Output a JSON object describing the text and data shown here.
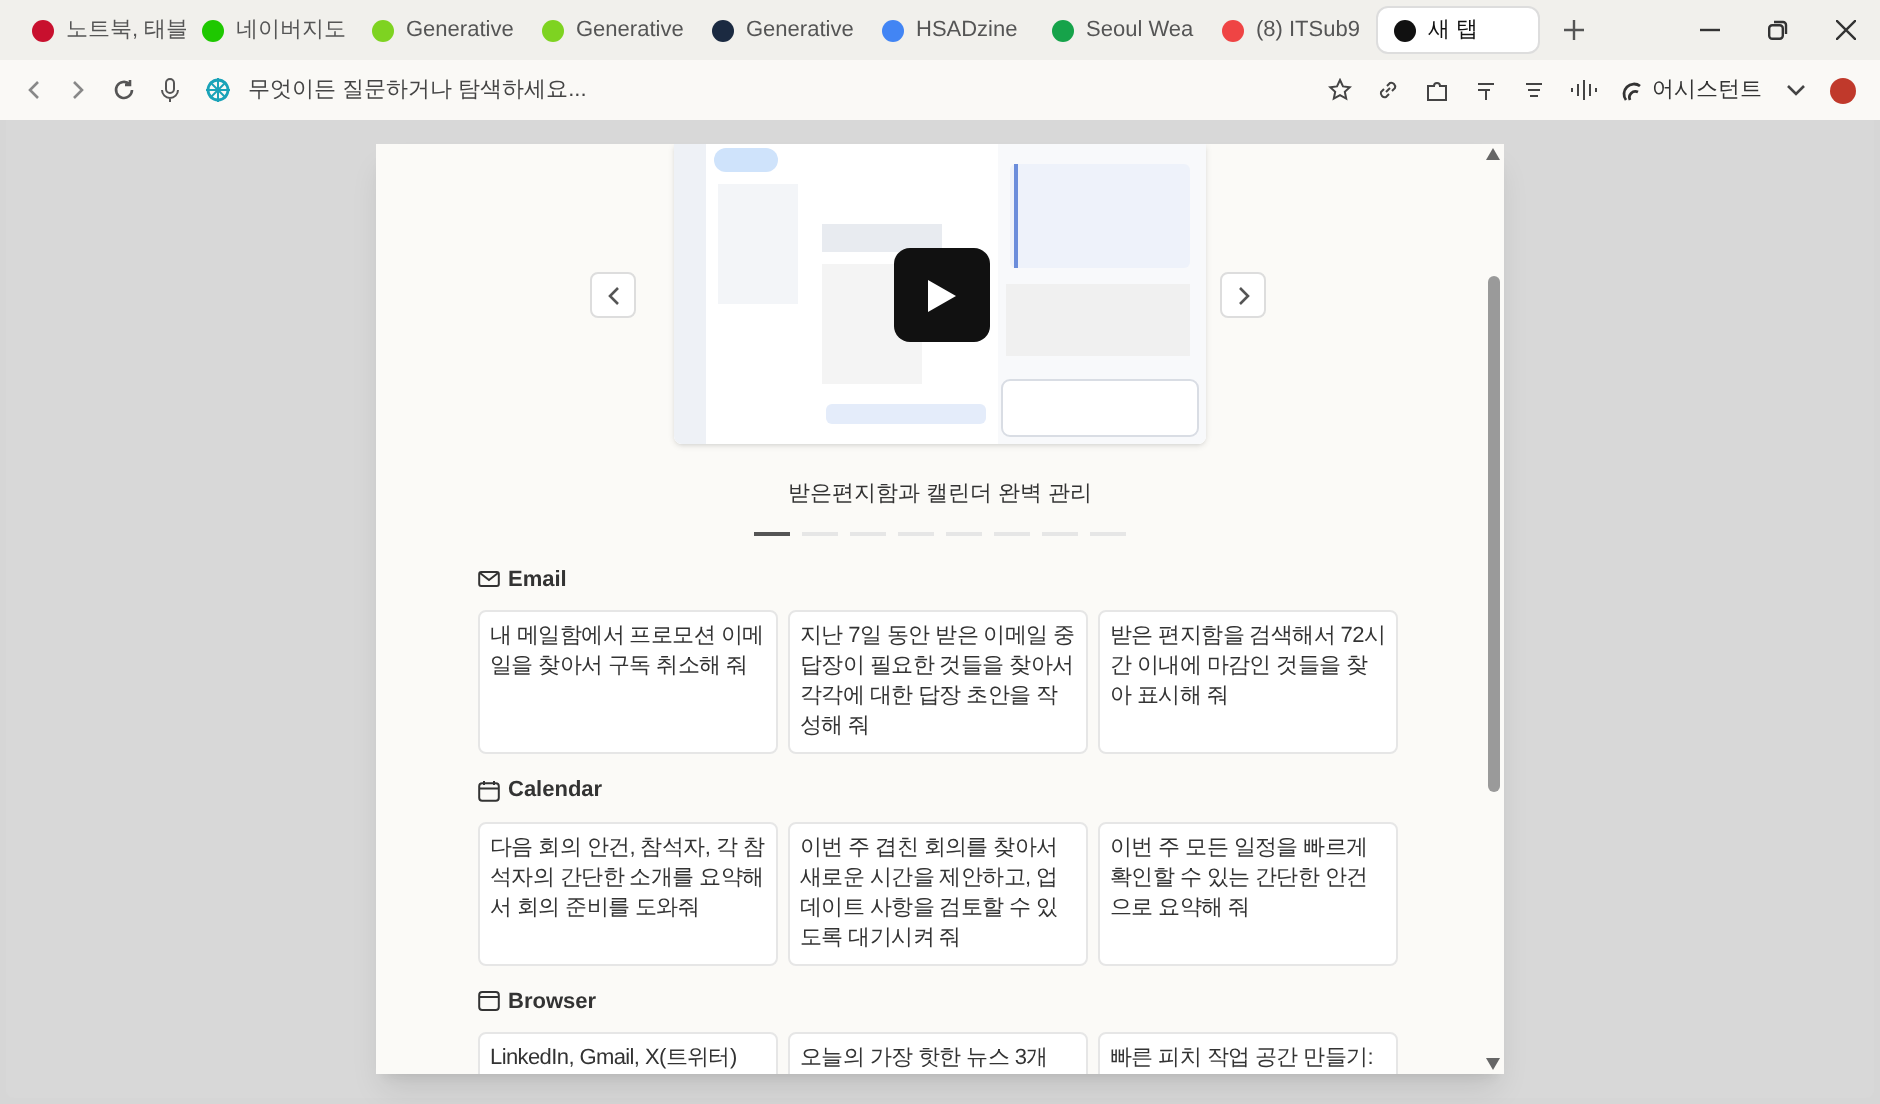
{
  "tabs": [
    {
      "title": "노트북, 태블",
      "color": "#c8102e",
      "selected": false
    },
    {
      "title": "네이버지도",
      "color": "#1ec800",
      "selected": false
    },
    {
      "title": "Generative",
      "color": "#7ed321",
      "selected": false
    },
    {
      "title": "Generative",
      "color": "#7ed321",
      "selected": false
    },
    {
      "title": "Generative",
      "color": "#1b2a41",
      "selected": false
    },
    {
      "title": "HSADzine",
      "color": "#4285f4",
      "selected": false
    },
    {
      "title": "Seoul Wea",
      "color": "#16a34a",
      "selected": false
    },
    {
      "title": "(8) ITSub9",
      "color": "#ef4444",
      "selected": false
    },
    {
      "title": "새 탭",
      "color": "#111111",
      "selected": true
    }
  ],
  "address_bar": {
    "placeholder": "무엇이든 질문하거나 탐색하세요..."
  },
  "assistant_button": "어시스턴트",
  "carousel": {
    "caption": "받은편지함과 캘린더 완벽 관리",
    "slides": [
      {
        "selected": true
      },
      {
        "selected": false
      },
      {
        "selected": false
      },
      {
        "selected": false
      },
      {
        "selected": false
      },
      {
        "selected": false
      },
      {
        "selected": false
      },
      {
        "selected": false
      }
    ]
  },
  "sections": [
    {
      "kind": "email",
      "title": "Email",
      "prompts": [
        "내 메일함에서 프로모션 이메일을 찾아서 구독 취소해 줘",
        "지난 7일 동안 받은 이메일 중 답장이 필요한 것들을 찾아서 각각에 대한 답장 초안을 작성해 줘",
        "받은 편지함을 검색해서 72시간 이내에 마감인 것들을 찾아 표시해 줘"
      ]
    },
    {
      "kind": "calendar",
      "title": "Calendar",
      "prompts": [
        "다음 회의 안건, 참석자, 각 참석자의 간단한 소개를 요약해서 회의 준비를 도와줘",
        "이번 주 겹친 회의를 찾아서 새로운 시간을 제안하고, 업데이트 사항을 검토할 수 있도록 대기시켜 줘",
        "이번 주 모든 일정을 빠르게 확인할 수 있는 간단한 안건으로 요약해 줘"
      ]
    },
    {
      "kind": "browser",
      "title": "Browser",
      "prompts": [
        "LinkedIn, Gmail, X(트위터)",
        "오늘의 가장 핫한 뉴스 3개",
        "빠른 피치 작업 공간 만들기:"
      ]
    }
  ]
}
